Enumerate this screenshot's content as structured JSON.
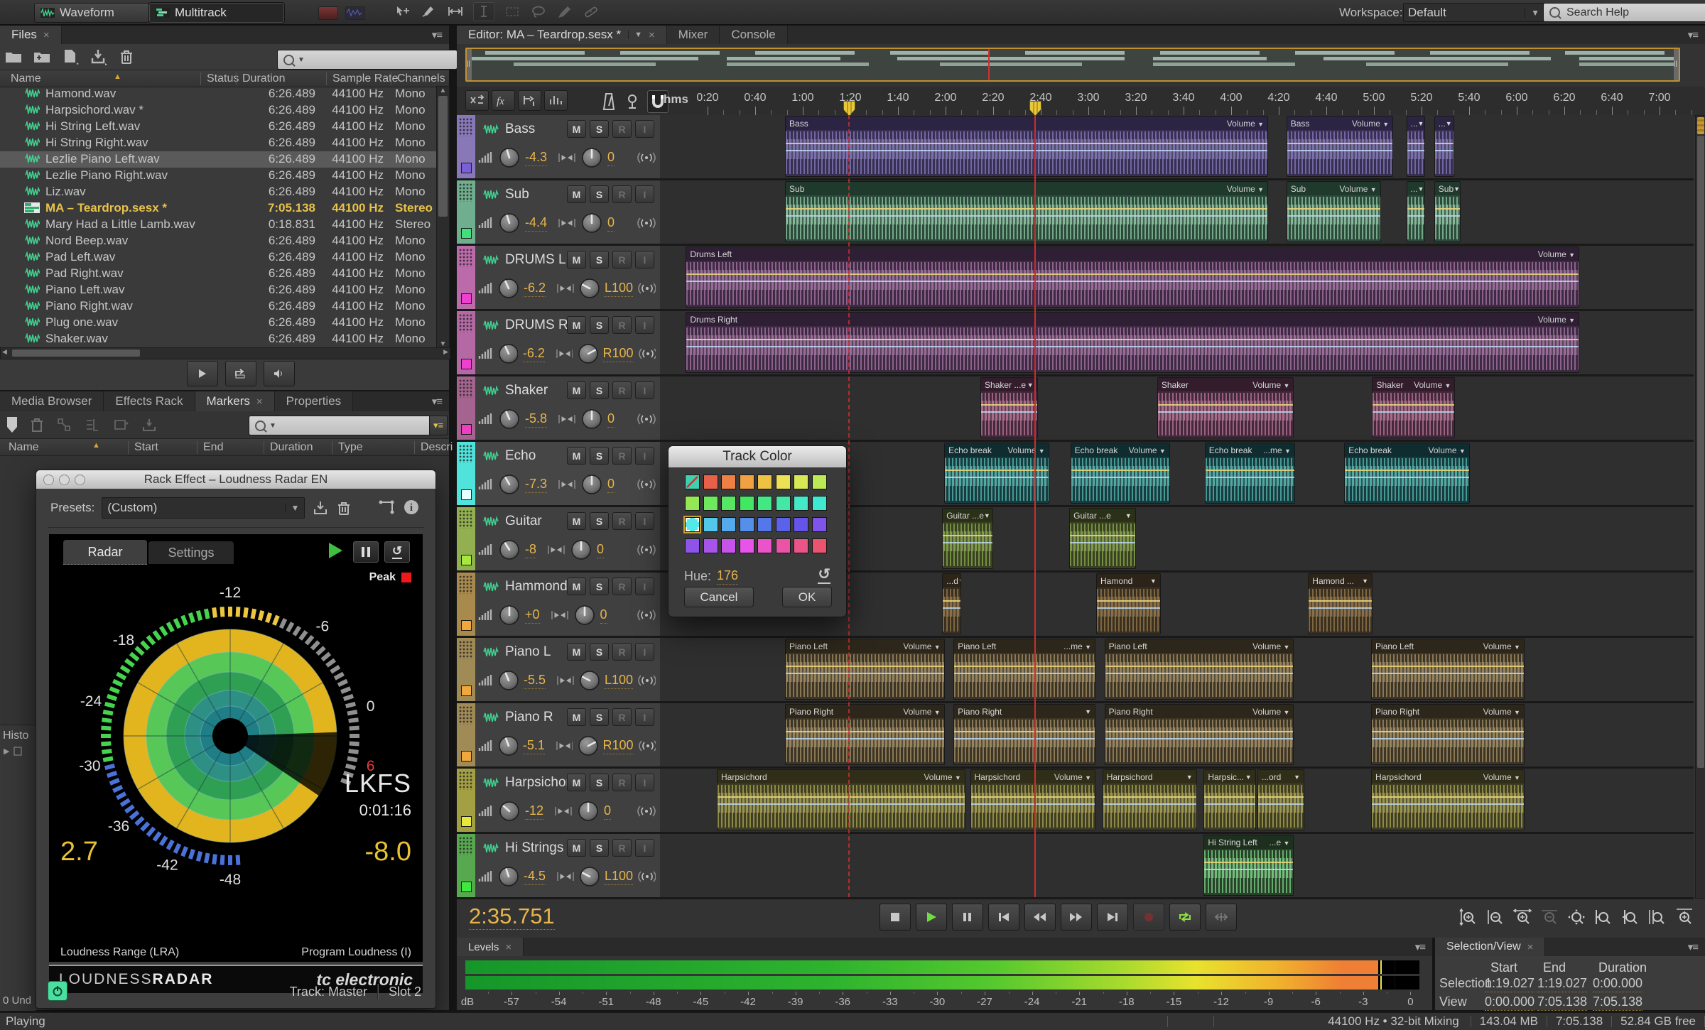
{
  "app": {
    "views": [
      {
        "label": "Waveform"
      },
      {
        "label": "Multitrack"
      }
    ],
    "workspace_label": "Workspace:",
    "workspace_value": "Default",
    "help_placeholder": "Search Help",
    "status_left": "Playing",
    "status_engine": "44100 Hz • 32-bit Mixing",
    "status_items": [
      "143.04 MB",
      "7:05.138",
      "52.84 GB free"
    ]
  },
  "files": {
    "tab": "Files",
    "columns": [
      "Name",
      "Status",
      "Duration",
      "Sample Rate",
      "Channels"
    ],
    "rows": [
      {
        "name": "Hamond.wav",
        "status": "",
        "dur": "6:26.489",
        "rate": "44100 Hz",
        "ch": "Mono",
        "type": "wav"
      },
      {
        "name": "Harpsichord.wav *",
        "status": "",
        "dur": "6:26.489",
        "rate": "44100 Hz",
        "ch": "Mono",
        "type": "wav"
      },
      {
        "name": "Hi String Left.wav",
        "status": "",
        "dur": "6:26.489",
        "rate": "44100 Hz",
        "ch": "Mono",
        "type": "wav"
      },
      {
        "name": "Hi String Right.wav",
        "status": "",
        "dur": "6:26.489",
        "rate": "44100 Hz",
        "ch": "Mono",
        "type": "wav"
      },
      {
        "name": "Lezlie Piano Left.wav",
        "status": "",
        "dur": "6:26.489",
        "rate": "44100 Hz",
        "ch": "Mono",
        "type": "wav",
        "selected": true
      },
      {
        "name": "Lezlie Piano Right.wav",
        "status": "",
        "dur": "6:26.489",
        "rate": "44100 Hz",
        "ch": "Mono",
        "type": "wav"
      },
      {
        "name": "Liz.wav",
        "status": "",
        "dur": "6:26.489",
        "rate": "44100 Hz",
        "ch": "Mono",
        "type": "wav"
      },
      {
        "name": "MA – Teardrop.sesx *",
        "status": "",
        "dur": "7:05.138",
        "rate": "44100 Hz",
        "ch": "Stereo",
        "type": "sesx"
      },
      {
        "name": "Mary Had a Little Lamb.wav",
        "status": "",
        "dur": "0:18.831",
        "rate": "44100 Hz",
        "ch": "Stereo",
        "type": "wav"
      },
      {
        "name": "Nord Beep.wav",
        "status": "",
        "dur": "6:26.489",
        "rate": "44100 Hz",
        "ch": "Mono",
        "type": "wav"
      },
      {
        "name": "Pad Left.wav",
        "status": "",
        "dur": "6:26.489",
        "rate": "44100 Hz",
        "ch": "Mono",
        "type": "wav"
      },
      {
        "name": "Pad Right.wav",
        "status": "",
        "dur": "6:26.489",
        "rate": "44100 Hz",
        "ch": "Mono",
        "type": "wav"
      },
      {
        "name": "Piano Left.wav",
        "status": "",
        "dur": "6:26.489",
        "rate": "44100 Hz",
        "ch": "Mono",
        "type": "wav"
      },
      {
        "name": "Piano Right.wav",
        "status": "",
        "dur": "6:26.489",
        "rate": "44100 Hz",
        "ch": "Mono",
        "type": "wav"
      },
      {
        "name": "Plug one.wav",
        "status": "",
        "dur": "6:26.489",
        "rate": "44100 Hz",
        "ch": "Mono",
        "type": "wav"
      },
      {
        "name": "Shaker.wav",
        "status": "",
        "dur": "6:26.489",
        "rate": "44100 Hz",
        "ch": "Mono",
        "type": "wav"
      }
    ]
  },
  "lower": {
    "tabs": [
      "Media Browser",
      "Effects Rack",
      "Markers",
      "Properties"
    ],
    "active_tab": "Markers",
    "markers_columns": [
      "Name",
      "Start",
      "End",
      "Duration",
      "Type",
      "Descri"
    ],
    "history_stub": "Histo",
    "undo_stub": "0 Und"
  },
  "radar": {
    "title": "Rack Effect – Loudness Radar EN",
    "presets_label": "Presets:",
    "preset_value": "(Custom)",
    "tabs": [
      "Radar",
      "Settings"
    ],
    "peak_label": "Peak",
    "scale_labels": [
      "-12",
      "-6",
      "0",
      "6",
      "-48",
      "-42",
      "-36",
      "-30",
      "-24",
      "-18"
    ],
    "unit": "LKFS",
    "time": "0:01:16",
    "lra_value": "2.7",
    "lra_label": "Loudness Range (LRA)",
    "pl_value": "-8.0",
    "pl_label": "Program Loudness (I)",
    "brand_left_a": "LOUDNESS",
    "brand_left_b": "RADAR",
    "brand_right": "tc electronic",
    "track_label": "Track: Master",
    "slot_label": "Slot 2"
  },
  "editor": {
    "tab": "Editor: MA – Teardrop.sesx *",
    "sibling_tabs": [
      "Mixer",
      "Console"
    ],
    "ruler_unit": "hms",
    "ruler_ticks": [
      "0:20",
      "0:40",
      "1:00",
      "1:20",
      "1:40",
      "2:00",
      "2:20",
      "2:40",
      "3:00",
      "3:20",
      "3:40",
      "4:00",
      "4:20",
      "4:40",
      "5:00",
      "5:20",
      "5:40",
      "6:00",
      "6:20",
      "6:40",
      "7:00"
    ],
    "timecode": "2:35.751",
    "msri": [
      "M",
      "S",
      "R",
      "I"
    ],
    "playhead_frac": 0.362,
    "selection_frac": 0.182,
    "tracks": [
      {
        "name": "Bass",
        "vol": "-4.3",
        "pan": "0",
        "strip": "#8878b8",
        "square": "#7a5fd6",
        "bg": "#383052",
        "wave": "#7b6fae",
        "lbg": "#2b2442",
        "clips": [
          [
            12.1,
            46.6,
            "Bass",
            "Volume"
          ],
          [
            60.6,
            10.2,
            "Bass",
            "Volume"
          ],
          [
            72.2,
            1.7,
            "...",
            ""
          ],
          [
            74.9,
            1.8,
            "...",
            ""
          ]
        ]
      },
      {
        "name": "Sub",
        "vol": "-4.4",
        "pan": "0",
        "strip": "#6fae8e",
        "square": "#42df7d",
        "bg": "#2c4a3b",
        "wave": "#83b795",
        "lbg": "#1f3a2d",
        "clips": [
          [
            12.1,
            46.6,
            "Sub",
            "Volume"
          ],
          [
            60.6,
            9.0,
            "Sub",
            "Volume"
          ],
          [
            72.2,
            1.7,
            "...",
            ""
          ],
          [
            74.9,
            2.4,
            "Sub",
            ""
          ]
        ]
      },
      {
        "name": "DRUMS L",
        "vol": "-6.2",
        "pan": "L100",
        "strip": "#bb6aaa",
        "square": "#ee3fd0",
        "bg": "#3e2b43",
        "wave": "#996b99",
        "lbg": "#2f1f34",
        "clips": [
          [
            2.5,
            86.3,
            "Drums Left",
            "Volume"
          ]
        ]
      },
      {
        "name": "DRUMS R",
        "vol": "-6.2",
        "pan": "R100",
        "strip": "#b469a5",
        "square": "#ee3fd0",
        "bg": "#3e2b43",
        "wave": "#996b99",
        "lbg": "#2f1f34",
        "clips": [
          [
            2.5,
            86.3,
            "Drums Right",
            "Volume"
          ]
        ]
      },
      {
        "name": "Shaker",
        "vol": "-5.8",
        "pan": "0",
        "strip": "#a5638f",
        "square": "#ee3fc0",
        "bg": "#43293b",
        "wave": "#aa6b8b",
        "lbg": "#331d2d",
        "clips": [
          [
            31.0,
            5.4,
            "Shaker ...e",
            ""
          ],
          [
            48.1,
            13.1,
            "Shaker",
            "Volume"
          ],
          [
            68.9,
            7.9,
            "Shaker",
            "Volume"
          ]
        ]
      },
      {
        "name": "Echo",
        "vol": "-7.3",
        "pan": "0",
        "strip": "#4fe3dc",
        "square": "#e8fffe",
        "bg": "#173c3f",
        "wave": "#4fa8a2",
        "lbg": "#0f2d30",
        "selected": true,
        "clips": [
          [
            27.5,
            10.0,
            "Echo break",
            "Volume"
          ],
          [
            39.7,
            9.5,
            "Echo break",
            "Volume"
          ],
          [
            52.7,
            8.6,
            "Echo break",
            "...me"
          ],
          [
            66.2,
            12.0,
            "Echo break",
            "Volume"
          ]
        ]
      },
      {
        "name": "Guitar",
        "vol": "-8",
        "pan": "0",
        "strip": "#93b050",
        "square": "#a6e83c",
        "bg": "#394120",
        "wave": "#7f9b4a",
        "lbg": "#2a3118",
        "clips": [
          [
            27.3,
            4.8,
            "Guitar ...e",
            ""
          ],
          [
            39.6,
            6.3,
            "Guitar  ...e",
            ""
          ]
        ]
      },
      {
        "name": "Hammond",
        "vol": "+0",
        "pan": "0",
        "strip": "#a98a4d",
        "square": "#f0a83c",
        "bg": "#3a3021",
        "wave": "#8a6f45",
        "lbg": "#2c2418",
        "clips": [
          [
            27.3,
            1.7,
            "...d",
            ""
          ],
          [
            42.2,
            6.1,
            "Hamond",
            ""
          ],
          [
            62.7,
            6.1,
            "Hamond ...",
            ""
          ]
        ]
      },
      {
        "name": "Piano L",
        "vol": "-5.5",
        "pan": "L100",
        "strip": "#a08a55",
        "square": "#f0a83c",
        "bg": "#3c3526",
        "wave": "#97835c",
        "lbg": "#2d271b",
        "clips": [
          [
            12.1,
            15.3,
            "Piano Left",
            "Volume"
          ],
          [
            28.4,
            13.6,
            "Piano Left",
            "...me"
          ],
          [
            43.0,
            18.2,
            "Piano Left",
            "Volume"
          ],
          [
            68.8,
            14.7,
            "Piano Left",
            "Volume"
          ]
        ]
      },
      {
        "name": "Piano R",
        "vol": "-5.1",
        "pan": "R100",
        "strip": "#a08a55",
        "square": "#f0a83c",
        "bg": "#3c3526",
        "wave": "#97835c",
        "lbg": "#2d271b",
        "clips": [
          [
            12.1,
            15.3,
            "Piano Right",
            "Volume"
          ],
          [
            28.4,
            13.6,
            "Piano Right",
            ""
          ],
          [
            43.0,
            18.2,
            "Piano Right",
            "Volume"
          ],
          [
            68.8,
            14.7,
            "Piano Right",
            "Volume"
          ]
        ]
      },
      {
        "name": "Harpsichord",
        "vol": "-12",
        "pan": "0",
        "strip": "#a3a043",
        "square": "#e8e83c",
        "bg": "#403e22",
        "wave": "#9b964d",
        "lbg": "#302e18",
        "clips": [
          [
            5.5,
            23.9,
            "Harpsichord",
            "Volume"
          ],
          [
            30.0,
            12.0,
            "Harpsichord",
            "Volume"
          ],
          [
            42.8,
            9.0,
            "Harpsichord",
            ""
          ],
          [
            52.6,
            4.9,
            "Harpsic...",
            ""
          ],
          [
            57.8,
            4.4,
            "...ord",
            ""
          ],
          [
            68.8,
            14.7,
            "Harpsichord",
            "Volume"
          ]
        ]
      },
      {
        "name": "Hi Strings L",
        "vol": "-4.5",
        "pan": "L100",
        "strip": "#57a84f",
        "square": "#3fe83f",
        "bg": "#29402a",
        "wave": "#6fbf78",
        "lbg": "#1d301e",
        "clips": [
          [
            52.6,
            8.6,
            "Hi String Left",
            "...e"
          ]
        ]
      }
    ]
  },
  "dialog": {
    "title": "Track Color",
    "hue_label": "Hue:",
    "hue_value": "176",
    "cancel": "Cancel",
    "ok": "OK",
    "selected_index": 16,
    "swatches": [
      "none",
      "#e8604a",
      "#ef8043",
      "#f0a243",
      "#eec343",
      "#ece054",
      "#d8e854",
      "#bdea54",
      "#93e854",
      "#6ee85c",
      "#54e865",
      "#43e862",
      "#43e884",
      "#43e8a6",
      "#43e8c6",
      "#3fe8d0",
      "#54e8e8",
      "#54c8ea",
      "#54aaea",
      "#5490ea",
      "#5478ea",
      "#5a62ea",
      "#6654ea",
      "#7e54ea",
      "#8e54ea",
      "#a654ea",
      "#c654ea",
      "#e654ea",
      "#ea54c8",
      "#ea54a6",
      "#ea5488",
      "#ea5470"
    ]
  },
  "levels": {
    "tab": "Levels",
    "ticks": [
      "dB",
      "-57",
      "-54",
      "-51",
      "-48",
      "-45",
      "-42",
      "-39",
      "-36",
      "-33",
      "-30",
      "-27",
      "-24",
      "-21",
      "-18",
      "-15",
      "-12",
      "-9",
      "-6",
      "-3",
      "0"
    ]
  },
  "selview": {
    "tab": "Selection/View",
    "columns": [
      "Start",
      "End",
      "Duration"
    ],
    "rows": [
      {
        "label": "Selection",
        "values": [
          "1:19.027",
          "1:19.027",
          "0:00.000"
        ]
      },
      {
        "label": "View",
        "values": [
          "0:00.000",
          "7:05.138",
          "7:05.138"
        ]
      }
    ]
  }
}
